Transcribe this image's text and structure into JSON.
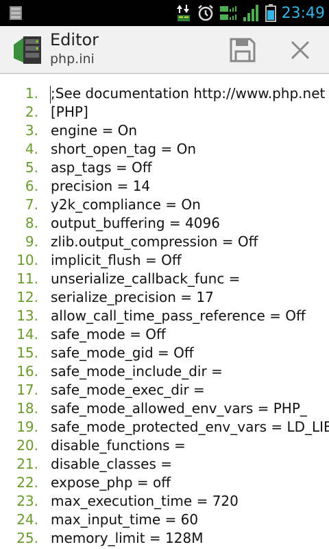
{
  "status": {
    "time": "23:49",
    "colors": {
      "time": "#33b5e5",
      "signal": "#4caf50"
    }
  },
  "app": {
    "title": "Editor",
    "subtitle": "php.ini"
  },
  "actions": {
    "save_icon": "save-icon",
    "close_icon": "close-icon"
  },
  "editor": {
    "line_number_color": "#6a9a2a",
    "lines": [
      {
        "num": "1.",
        "text": ";See documentation http://www.php.net"
      },
      {
        "num": "2.",
        "text": "[PHP]"
      },
      {
        "num": "3.",
        "text": "engine = On"
      },
      {
        "num": "4.",
        "text": "short_open_tag = On"
      },
      {
        "num": "5.",
        "text": "asp_tags = Off"
      },
      {
        "num": "6.",
        "text": "precision = 14"
      },
      {
        "num": "7.",
        "text": "y2k_compliance = On"
      },
      {
        "num": "8.",
        "text": "output_buffering = 4096"
      },
      {
        "num": "9.",
        "text": "zlib.output_compression = Off"
      },
      {
        "num": "10.",
        "text": "implicit_flush = Off"
      },
      {
        "num": "11.",
        "text": "unserialize_callback_func ="
      },
      {
        "num": "12.",
        "text": "serialize_precision = 17"
      },
      {
        "num": "13.",
        "text": "allow_call_time_pass_reference = Off"
      },
      {
        "num": "14.",
        "text": "safe_mode = Off"
      },
      {
        "num": "15.",
        "text": "safe_mode_gid = Off"
      },
      {
        "num": "16.",
        "text": "safe_mode_include_dir ="
      },
      {
        "num": "17.",
        "text": "safe_mode_exec_dir ="
      },
      {
        "num": "18.",
        "text": "safe_mode_allowed_env_vars = PHP_"
      },
      {
        "num": "19.",
        "text": "safe_mode_protected_env_vars = LD_LIBRARY_PATH"
      },
      {
        "num": "20.",
        "text": "disable_functions ="
      },
      {
        "num": "21.",
        "text": "disable_classes ="
      },
      {
        "num": "22.",
        "text": "expose_php = off"
      },
      {
        "num": "23.",
        "text": "max_execution_time = 720"
      },
      {
        "num": "24.",
        "text": "max_input_time = 60"
      },
      {
        "num": "25.",
        "text": "memory_limit = 128M"
      }
    ]
  }
}
